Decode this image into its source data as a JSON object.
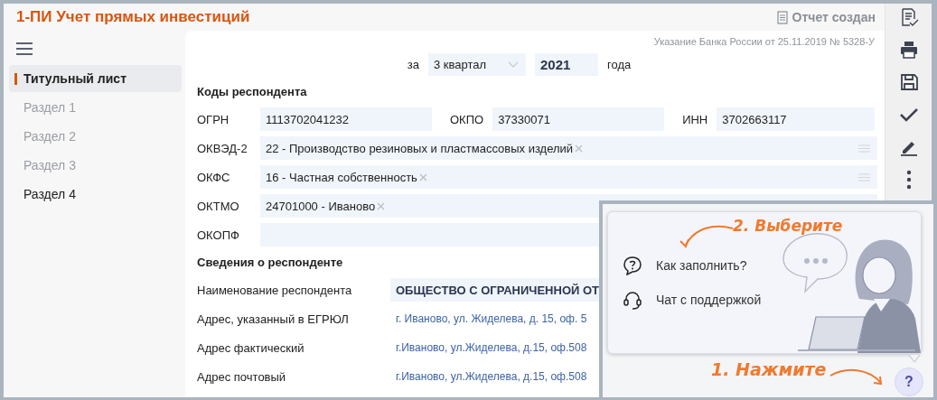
{
  "header": {
    "title": "1-ПИ Учет прямых инвестиций",
    "status": "Отчет создан"
  },
  "sidebar": {
    "items": [
      {
        "label": "Титульный лист",
        "selected": true,
        "disabled": false
      },
      {
        "label": "Раздел 1",
        "selected": false,
        "disabled": true
      },
      {
        "label": "Раздел 2",
        "selected": false,
        "disabled": true
      },
      {
        "label": "Раздел 3",
        "selected": false,
        "disabled": true
      },
      {
        "label": "Раздел 4",
        "selected": false,
        "disabled": false
      }
    ]
  },
  "form": {
    "regulation": "Указание Банка России от 25.11.2019 № 5328-У",
    "period": {
      "prefix": "за",
      "quarter": "3 квартал",
      "year": "2021",
      "suffix": "года"
    },
    "codes": {
      "title": "Коды респондента",
      "inline_fields": [
        {
          "label": "ОГРН",
          "value": "1113702041232"
        },
        {
          "label": "ОКПО",
          "value": "37330071"
        },
        {
          "label": "ИНН",
          "value": "3702663117"
        }
      ],
      "selects": [
        {
          "label": "ОКВЭД-2",
          "tag": "22 - Производство резиновых и пластмассовых изделий",
          "list_button": true
        },
        {
          "label": "ОКФС",
          "tag": "16 - Частная собственность",
          "list_button": true
        },
        {
          "label": "ОКТМО",
          "tag": "24701000 - Иваново"
        },
        {
          "label": "ОКОПФ"
        }
      ]
    },
    "respondent": {
      "title": "Сведения о респонденте",
      "rows": [
        {
          "label": "Наименование респондента",
          "value": "ОБЩЕСТВО С ОГРАНИЧЕННОЙ ОТ",
          "kind": "field"
        },
        {
          "label": "Адрес, указанный в ЕГРЮЛ",
          "value": "г. Иваново, ул. Жиделева, д. 15, оф. 5",
          "kind": "text"
        },
        {
          "label": "Адрес фактический",
          "value": "г.Иваново, ул.Жиделева, д.15, оф.508",
          "kind": "text"
        },
        {
          "label": "Адрес почтовый",
          "value": "г.Иваново, ул.Жиделева, д.15, оф.508",
          "kind": "text"
        }
      ]
    }
  },
  "help": {
    "hint_choose": "2. Выберите",
    "hint_press": "1. Нажмите",
    "items": [
      {
        "label": "Как заполнить?",
        "kind": "question"
      },
      {
        "label": "Чат с поддержкой",
        "kind": "support"
      }
    ],
    "button": "?"
  }
}
